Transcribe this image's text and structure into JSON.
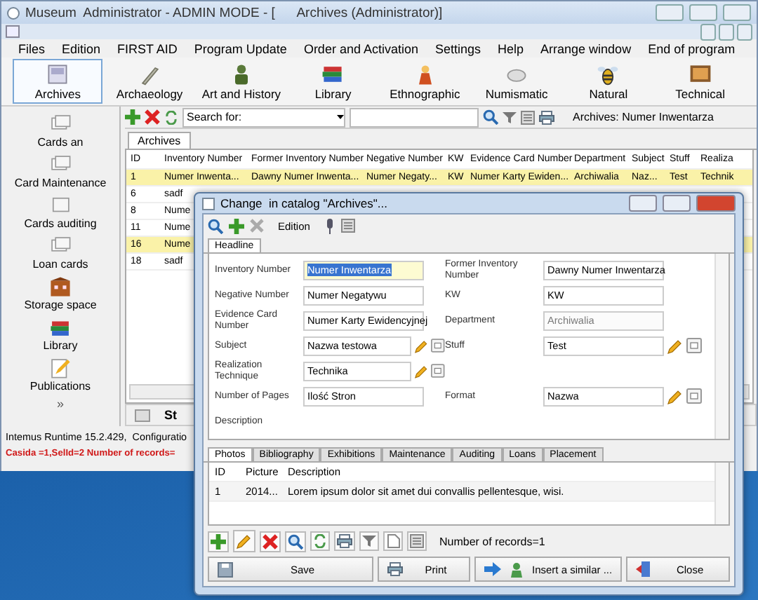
{
  "window": {
    "title": "Museum  Administrator - ADMIN MODE - [      Archives (Administrator)]"
  },
  "menu": [
    "Files",
    "Edition",
    "FIRST AID",
    "Program Update",
    "Order and Activation",
    "Settings",
    "Help",
    "Arrange window",
    "End of program"
  ],
  "modules": [
    {
      "label": "Archives",
      "selected": true
    },
    {
      "label": "Archaeology",
      "selected": false
    },
    {
      "label": "Art and History",
      "selected": false
    },
    {
      "label": "Library",
      "selected": false
    },
    {
      "label": "Ethnographic",
      "selected": false
    },
    {
      "label": "Numismatic",
      "selected": false
    },
    {
      "label": "Natural",
      "selected": false
    },
    {
      "label": "Technical",
      "selected": false
    }
  ],
  "sidebar": {
    "items": [
      "Cards an",
      "Card Maintenance",
      "Cards auditing",
      "Loan cards",
      "Storage space",
      "Library",
      "Publications"
    ],
    "more": "»"
  },
  "search": {
    "label": "Search for:",
    "context": "Archives: Numer Inwentarza"
  },
  "list_tabs": [
    {
      "label": "Archives",
      "selected": true
    }
  ],
  "table": {
    "columns": [
      "ID",
      "Inventory Number",
      "Former Inventory Number",
      "Negative Number",
      "KW",
      "Evidence Card Number",
      "Department",
      "Subject",
      "Stuff",
      "Realiza"
    ],
    "rows": [
      {
        "cells": [
          "1",
          "Numer Inwenta...",
          "Dawny Numer Inwenta...",
          "Numer Negaty...",
          "KW",
          "Numer Karty Ewiden...",
          "Archiwalia",
          "Naz...",
          "Test",
          "Technik"
        ],
        "selected": true
      },
      {
        "cells": [
          "6",
          "sadf"
        ],
        "selected": false
      },
      {
        "cells": [
          "8",
          "Nume"
        ],
        "selected": false
      },
      {
        "cells": [
          "11",
          "Nume"
        ],
        "selected": false
      },
      {
        "cells": [
          "16",
          "Nume"
        ],
        "selected": true
      },
      {
        "cells": [
          "18",
          "sadf"
        ],
        "selected": false
      }
    ]
  },
  "bottom_label": "St",
  "status_bar": {
    "runtime": "Intemus Runtime 15.2.429,  Configuratio",
    "records": "Casida =1,SelId=2 Number of records="
  },
  "dialog": {
    "title": "Change  in catalog \"Archives\"...",
    "toolbar_label": "Edition",
    "tabs": [
      {
        "label": "Headline",
        "selected": true
      }
    ],
    "form_rows": [
      [
        {
          "label": "Inventory Number",
          "value": "Numer Inwentarza",
          "kind": "text",
          "selected": true,
          "disabled": false
        },
        {
          "label": "Former Inventory Number",
          "value": "Dawny Numer Inwentarza",
          "kind": "text",
          "selected": false,
          "disabled": false
        }
      ],
      [
        {
          "label": "Negative Number",
          "value": "Numer Negatywu",
          "kind": "text",
          "selected": false,
          "disabled": false
        },
        {
          "label": "KW",
          "value": "KW",
          "kind": "text",
          "selected": false,
          "disabled": false
        }
      ],
      [
        {
          "label": "Evidence Card Number",
          "value": "Numer Karty Ewidencyjnej",
          "kind": "text",
          "selected": false,
          "disabled": false
        },
        {
          "label": "Department",
          "value": "Archiwalia",
          "kind": "text",
          "selected": false,
          "disabled": true
        }
      ],
      [
        {
          "label": "Subject",
          "value": "Nazwa testowa",
          "kind": "lookup",
          "selected": false,
          "disabled": false
        },
        {
          "label": "Stuff",
          "value": "Test",
          "kind": "lookup",
          "selected": false,
          "disabled": false
        }
      ],
      [
        {
          "label": "Realization Technique",
          "value": "Technika",
          "kind": "lookup",
          "selected": false,
          "disabled": false
        }
      ],
      [
        {
          "label": "Number of Pages",
          "value": "Ilość Stron",
          "kind": "text",
          "selected": false,
          "disabled": false
        },
        {
          "label": "Format",
          "value": "Nazwa",
          "kind": "lookup",
          "selected": false,
          "disabled": false
        }
      ],
      [
        {
          "label": "Description",
          "kind": "label"
        }
      ]
    ],
    "subtabs": [
      {
        "label": "Photos",
        "selected": true
      },
      {
        "label": "Bibliography",
        "selected": false
      },
      {
        "label": "Exhibitions",
        "selected": false
      },
      {
        "label": "Maintenance",
        "selected": false
      },
      {
        "label": "Auditing",
        "selected": false
      },
      {
        "label": "Loans",
        "selected": false
      },
      {
        "label": "Placement",
        "selected": false
      }
    ],
    "grid": {
      "columns": [
        "ID",
        "Picture",
        "Description"
      ],
      "rows": [
        [
          "1",
          "2014...",
          "Lorem ipsum dolor sit amet dui convallis pellentesque, wisi."
        ]
      ]
    },
    "records": "Number of records=1",
    "buttons": [
      "Save",
      "Print",
      "Insert a similar ...",
      "Close"
    ]
  }
}
